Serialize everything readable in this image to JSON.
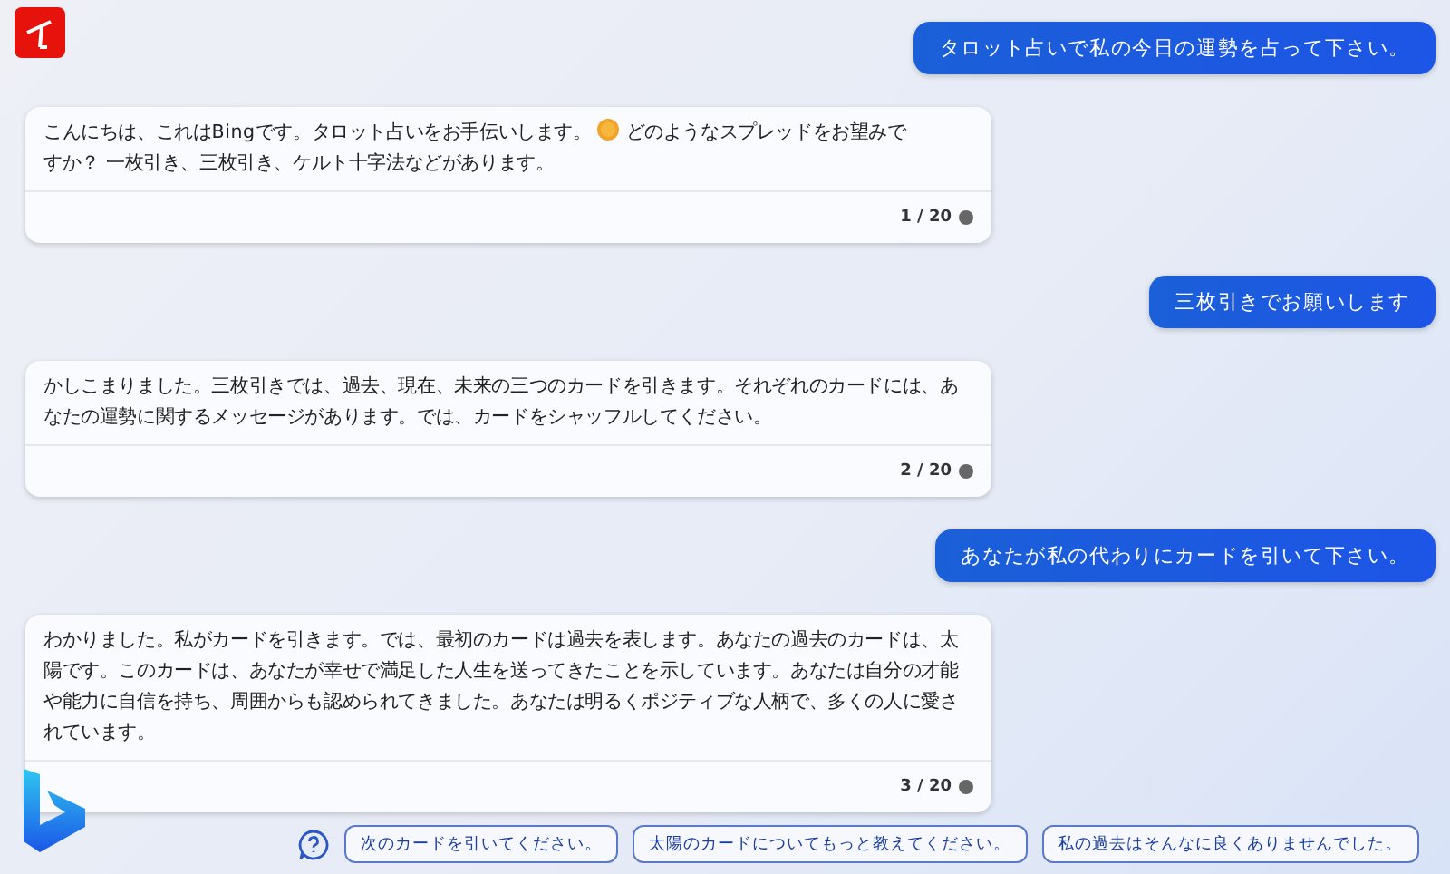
{
  "messages": [
    {
      "kind": "user",
      "text": "タロット占いで私の今日の運勢を占って下さい。"
    },
    {
      "kind": "bot",
      "segments": [
        {
          "kind": "text",
          "text": "こんにちは、これはBingです。タロット占いをお手伝いします。"
        },
        {
          "kind": "emoji"
        },
        {
          "kind": "text",
          "text": "どのようなスプレッドをお望みで"
        },
        {
          "kind": "text",
          "text": "すか？ 一枚引き、三枚引き、ケルト十字法などがあります。"
        }
      ],
      "counter": "1 / 20"
    },
    {
      "kind": "user",
      "text": "三枚引きでお願いします"
    },
    {
      "kind": "bot",
      "segments": [
        {
          "kind": "text",
          "text": "かしこまりました。三枚引きでは、過去、現在、未来の三つのカードを引きます。それぞれのカードには、あなたの運勢に関するメッセージがあります。では、カードをシャッフルしてください。"
        }
      ],
      "counter": "2 / 20"
    },
    {
      "kind": "user",
      "text": "あなたが私の代わりにカードを引いて下さい。"
    },
    {
      "kind": "bot",
      "segments": [
        {
          "kind": "text",
          "text": "わかりました。私がカードを引きます。では、最初のカードは過去を表します。あなたの過去のカードは、太陽です。このカードは、あなたが幸せで満足した人生を送ってきたことを示しています。あなたは自分の才能や能力に自信を持ち、周囲からも認められてきました。あなたは明るくポジティブな人柄で、多くの人に愛されています。"
        }
      ],
      "counter": "3 / 20"
    }
  ],
  "suggestions": [
    "次のカードを引いてください。",
    "太陽のカードについてもっと教えてください。",
    "私の過去はそんなに良くありませんでした。"
  ]
}
